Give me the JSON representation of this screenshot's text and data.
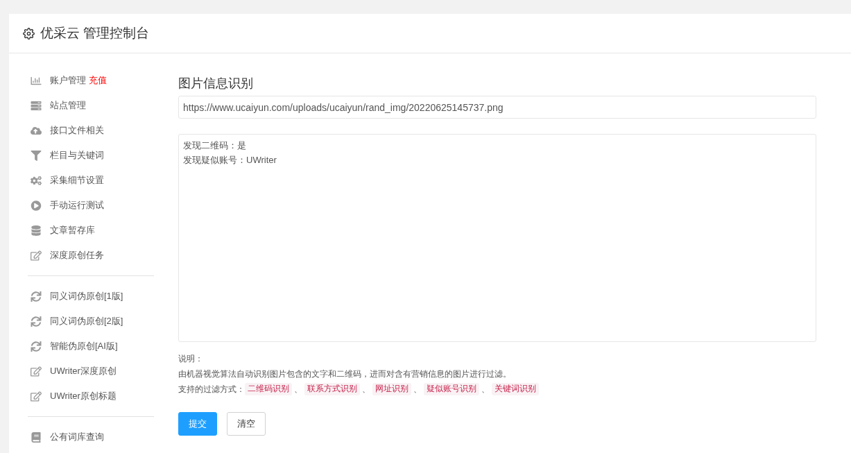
{
  "header": {
    "title": "优采云 管理控制台"
  },
  "sidebar": {
    "groups": [
      {
        "items": [
          {
            "label": "账户管理",
            "badge": "充值"
          },
          {
            "label": "站点管理"
          },
          {
            "label": "接口文件相关"
          },
          {
            "label": "栏目与关键词"
          },
          {
            "label": "采集细节设置"
          },
          {
            "label": "手动运行测试"
          },
          {
            "label": "文章暂存库"
          },
          {
            "label": "深度原创任务"
          }
        ]
      },
      {
        "items": [
          {
            "label": "同义词伪原创[1版]"
          },
          {
            "label": "同义词伪原创[2版]"
          },
          {
            "label": "智能伪原创[AI版]"
          },
          {
            "label": "UWriter深度原创"
          },
          {
            "label": "UWriter原创标题"
          }
        ]
      },
      {
        "items": [
          {
            "label": "公有词库查询"
          }
        ]
      }
    ]
  },
  "main": {
    "title": "图片信息识别",
    "url_field": {
      "value": "https://www.ucaiyun.com/uploads/ucaiyun/rand_img/20220625145737.png"
    },
    "result_box": {
      "lines": [
        "发现二维码：是",
        "发现疑似账号：UWriter"
      ]
    },
    "notes": {
      "heading": "说明：",
      "text": "由机器视觉算法自动识别图片包含的文字和二维码，进而对含有营销信息的图片进行过滤。",
      "filters_label": "支持的过滤方式：",
      "separator": "、",
      "filters": [
        "二维码识别",
        "联系方式识别",
        "网址识别",
        "疑似账号识别",
        "关键词识别"
      ]
    },
    "buttons": [
      {
        "label": "提交",
        "kind": "primary"
      },
      {
        "label": "清空",
        "kind": "default"
      }
    ]
  }
}
